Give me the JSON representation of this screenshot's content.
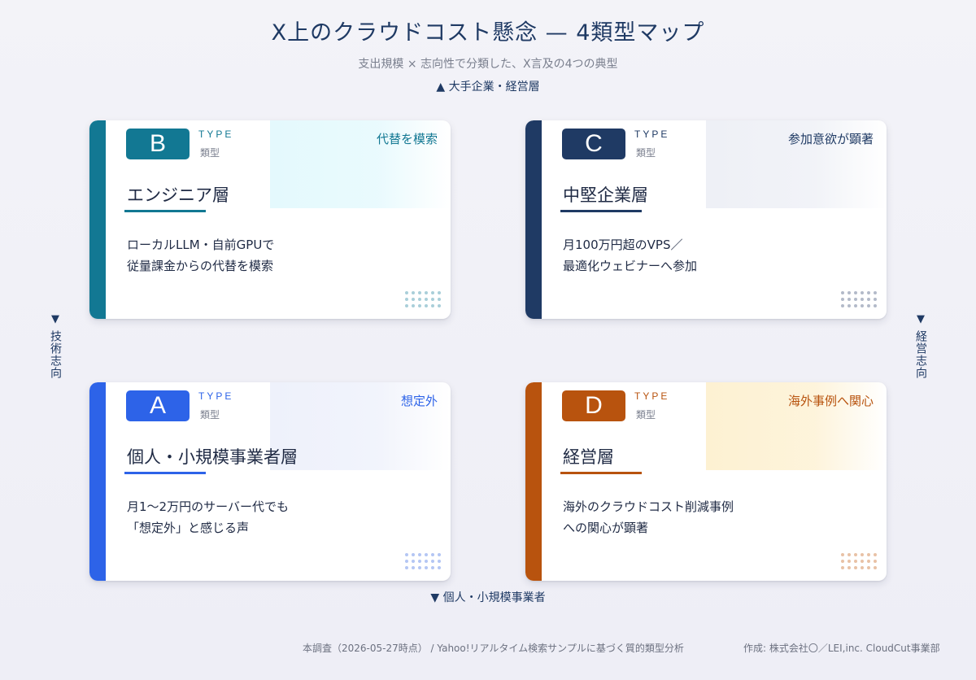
{
  "title": "X上のクラウドコスト懸念 — 4類型マップ",
  "subtitle": "支出規模 × 志向性で分類した、X言及の4つの典型",
  "axes": {
    "top": "大手企業・経営層",
    "bottom": "個人・小規模事業者",
    "left": "技術志向",
    "right": "経営志向",
    "up_arrow": "▲",
    "down_arrow": "▼"
  },
  "type_en": "TYPE",
  "type_jp": "類型",
  "cards": {
    "b": {
      "letter": "B",
      "tag": "代替を模索",
      "name": "エンジニア層",
      "desc1": "ローカルLLM・自前GPUで",
      "desc2": "従量課金からの代替を模索",
      "color": "#127893",
      "wash": "#e4f9fd",
      "dot": "#a9cfd9"
    },
    "c": {
      "letter": "C",
      "tag": "参加意欲が顕著",
      "name": "中堅企業層",
      "desc1": "月100万円超のVPS／",
      "desc2": "最適化ウェビナーへ参加",
      "color": "#1f3a64",
      "wash": "#eef0f6",
      "dot": "#b3bac9"
    },
    "a": {
      "letter": "A",
      "tag": "想定外",
      "name": "個人・小規模事業者層",
      "desc1": "月1〜2万円のサーバー代でも",
      "desc2": "「想定外」と感じる声",
      "color": "#2d63e8",
      "wash": "#eef1fb",
      "dot": "#b4c6f4"
    },
    "d": {
      "letter": "D",
      "tag": "海外事例へ関心",
      "name": "経営層",
      "desc1": "海外のクラウドコスト削減事例",
      "desc2": "への関心が顕著",
      "color": "#b8530e",
      "wash": "#fdf1d2",
      "dot": "#e8c2a6"
    }
  },
  "footer": {
    "source": "本調査（2026-05-27時点） / Yahoo!リアルタイム検索サンプルに基づく質的類型分析",
    "credit": "作成: 株式会社〇／LEI,inc. CloudCut事業部"
  }
}
